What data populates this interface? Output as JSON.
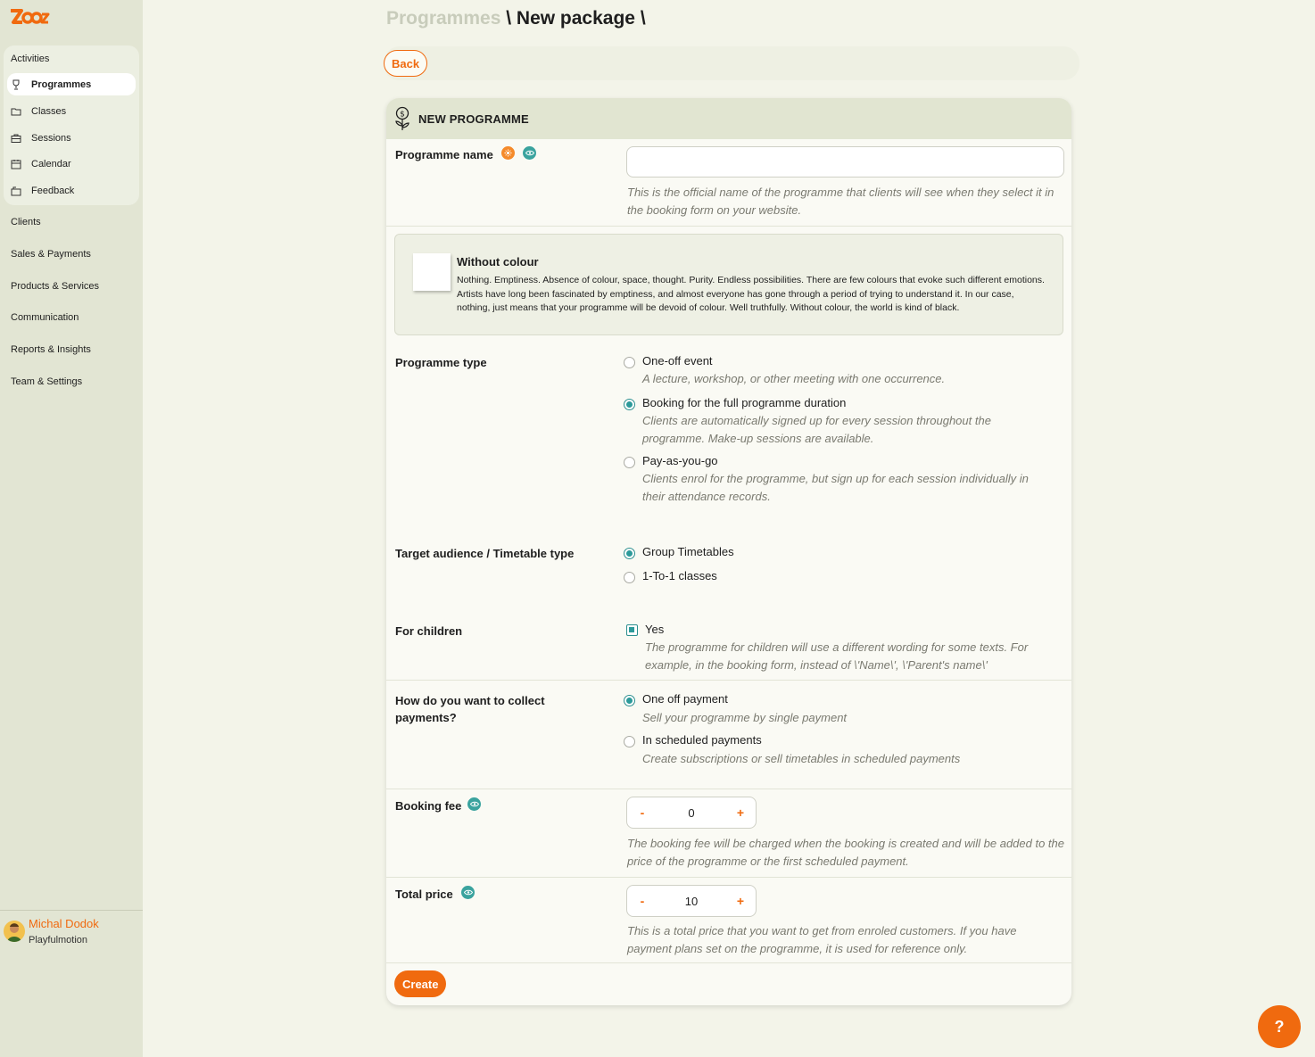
{
  "sidebar": {
    "logo_text": "Zooza",
    "activities_label": "Activities",
    "items": [
      {
        "label": "Programmes",
        "icon": "trophy-icon"
      },
      {
        "label": "Classes",
        "icon": "folder-icon"
      },
      {
        "label": "Sessions",
        "icon": "briefcase-icon"
      },
      {
        "label": "Calendar",
        "icon": "calendar-icon"
      },
      {
        "label": "Feedback",
        "icon": "feedback-icon"
      }
    ],
    "sections": [
      "Clients",
      "Sales & Payments",
      "Products & Services",
      "Communication",
      "Reports & Insights",
      "Team & Settings"
    ],
    "user": {
      "name": "Michal Dodok",
      "org": "Playfulmotion"
    }
  },
  "header": {
    "crumb_parent": "Programmes",
    "crumb_sep1": " \\ ",
    "crumb_current": "New package",
    "crumb_sep2": " \\",
    "back_label": "Back"
  },
  "form": {
    "card_title": "NEW PROGRAMME",
    "name": {
      "label": "Programme name",
      "value": "",
      "hint": "This is the official name of the programme that clients will see when they select it in the booking form on your website."
    },
    "colour": {
      "title": "Without colour",
      "description": "Nothing. Emptiness. Absence of colour, space, thought. Purity. Endless possibilities. There are few colours that evoke such different emotions. Artists have long been fascinated by emptiness, and almost everyone has gone through a period of trying to understand it. In our case, nothing, just means that your programme will be devoid of colour. Well truthfully. Without colour, the world is kind of black.",
      "swatch": "#ffffff"
    },
    "type": {
      "label": "Programme type",
      "options": [
        {
          "label": "One-off event",
          "hint": "A lecture, workshop, or other meeting with one occurrence.",
          "selected": false
        },
        {
          "label": "Booking for the full programme duration",
          "hint": "Clients are automatically signed up for every session throughout the programme. Make-up sessions are available.",
          "selected": true
        },
        {
          "label": "Pay-as-you-go",
          "hint": "Clients enrol for the programme, but sign up for each session individually in their attendance records.",
          "selected": false
        }
      ]
    },
    "audience": {
      "label": "Target audience / Timetable type",
      "options": [
        {
          "label": "Group Timetables",
          "selected": true
        },
        {
          "label": "1-To-1 classes",
          "selected": false
        }
      ]
    },
    "children": {
      "label": "For children",
      "option": "Yes",
      "checked": true,
      "hint": "The programme for children will use a different wording for some texts. For example, in the booking form, instead of \\'Name\\', \\'Parent's name\\'"
    },
    "payments": {
      "label": "How do you want to collect payments?",
      "options": [
        {
          "label": "One off payment",
          "hint": "Sell your programme by single payment",
          "selected": true
        },
        {
          "label": "In scheduled payments",
          "hint": "Create subscriptions or sell timetables in scheduled payments",
          "selected": false
        }
      ]
    },
    "booking_fee": {
      "label": "Booking fee",
      "value": "0",
      "hint": "The booking fee will be charged when the booking is created and will be added to the price of the programme or the first scheduled payment."
    },
    "total_price": {
      "label": "Total price",
      "value": "10",
      "hint": "This is a total price that you want to get from enroled customers. If you have payment plans set on the programme, it is used for reference only."
    },
    "stepper_minus": "-",
    "stepper_plus": "+",
    "create_label": "Create"
  },
  "help_label": "?",
  "colors": {
    "accent": "#f06a0f",
    "teal": "#2c9a9a",
    "sidebar": "#e2e5d3"
  }
}
